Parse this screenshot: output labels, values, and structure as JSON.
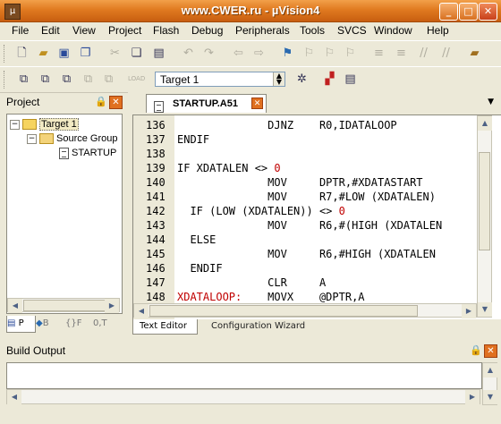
{
  "window": {
    "title": "www.CWER.ru - µVision4",
    "minimize": "_",
    "maximize": "□",
    "close": "✕"
  },
  "menu": [
    "File",
    "Edit",
    "View",
    "Project",
    "Flash",
    "Debug",
    "Peripherals",
    "Tools",
    "SVCS",
    "Window",
    "Help"
  ],
  "toolbar2": {
    "target": "Target 1",
    "load_label": "LOAD"
  },
  "project_panel": {
    "title": "Project",
    "tree": {
      "target": "Target 1",
      "group": "Source Group",
      "file": "STARTUP"
    },
    "tabs": [
      "P",
      "B",
      "{}F",
      "0,T"
    ]
  },
  "editor": {
    "tab_name": "STARTUP.A51",
    "lines": [
      {
        "n": "136",
        "code": "              DJNZ    R0,IDATALOOP"
      },
      {
        "n": "137",
        "code": "ENDIF"
      },
      {
        "n": "138",
        "code": ""
      },
      {
        "n": "139",
        "code": "IF XDATALEN <> 0"
      },
      {
        "n": "140",
        "code": "              MOV     DPTR,#XDATASTART"
      },
      {
        "n": "141",
        "code": "              MOV     R7,#LOW (XDATALEN)"
      },
      {
        "n": "142",
        "code": "  IF (LOW (XDATALEN)) <> 0"
      },
      {
        "n": "143",
        "code": "              MOV     R6,#(HIGH (XDATALEN"
      },
      {
        "n": "144",
        "code": "  ELSE"
      },
      {
        "n": "145",
        "code": "              MOV     R6,#HIGH (XDATALEN"
      },
      {
        "n": "146",
        "code": "  ENDIF"
      },
      {
        "n": "147",
        "code": "              CLR     A"
      },
      {
        "n": "148",
        "code": "XDATALOOP:    MOVX    @DPTR,A"
      }
    ],
    "bottom_tabs": [
      "Text Editor",
      "Configuration Wizard"
    ]
  },
  "build_output": {
    "title": "Build Output"
  }
}
